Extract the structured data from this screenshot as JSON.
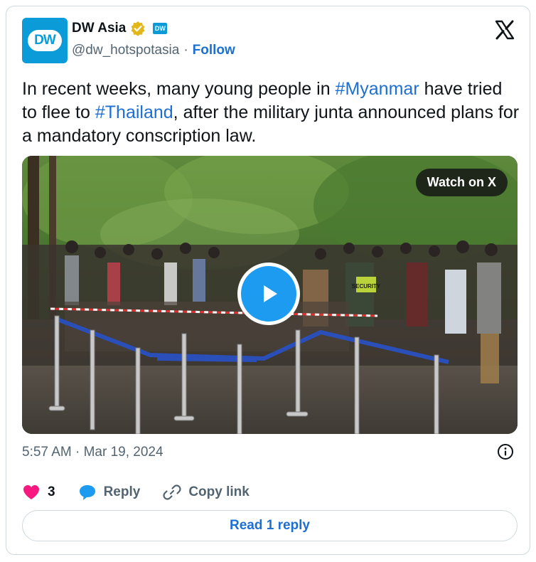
{
  "author": {
    "name": "DW Asia",
    "avatar_text": "DW",
    "affiliate_badge_text": "DW",
    "handle": "@dw_hotspotasia",
    "separator": "·",
    "follow_label": "Follow"
  },
  "tweet": {
    "text_part1": "In recent weeks, many young people in ",
    "hashtag1": "#Myanmar",
    "text_part2": " have tried to flee to ",
    "hashtag2": "#Thailand",
    "text_part3": ", after the military junta announced plans for a mandatory conscription law."
  },
  "media": {
    "watch_label": "Watch on X",
    "security_vest_text": "SECURITY"
  },
  "timestamp": "5:57 AM · Mar 19, 2024",
  "actions": {
    "like_count": "3",
    "reply_label": "Reply",
    "copy_link_label": "Copy link"
  },
  "read_replies_label": "Read 1 reply",
  "colors": {
    "accent": "#1d9bf0",
    "link": "#1d6fd1",
    "heart": "#f91880",
    "dw_blue": "#0a9bd8",
    "verified_gold": "#e2b719"
  }
}
